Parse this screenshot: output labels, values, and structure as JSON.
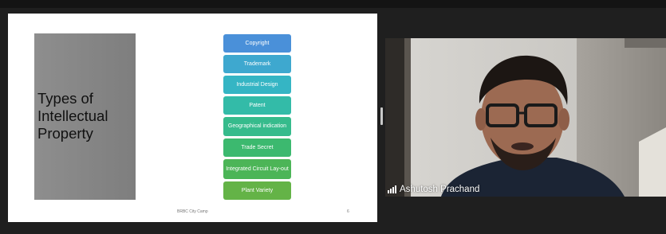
{
  "slide": {
    "title": "Types of Intellectual Property",
    "items": [
      {
        "label": "Copyright",
        "color": "#4a90d9"
      },
      {
        "label": "Trademark",
        "color": "#3ea8cf"
      },
      {
        "label": "Industrial Design",
        "color": "#35b5c4"
      },
      {
        "label": "Patent",
        "color": "#33bba8"
      },
      {
        "label": "Geographical indication",
        "color": "#36bb8c"
      },
      {
        "label": "Trade Secret",
        "color": "#3cb96f"
      },
      {
        "label": "Integrated Circuit Lay-out",
        "color": "#4cb557"
      },
      {
        "label": "Plant Variety",
        "color": "#64b347"
      }
    ],
    "footer": "BRBC City Camp",
    "page_number": "6"
  },
  "video": {
    "participant_name": "Ashutosh Prachand",
    "icon": "signal-bars-icon"
  }
}
